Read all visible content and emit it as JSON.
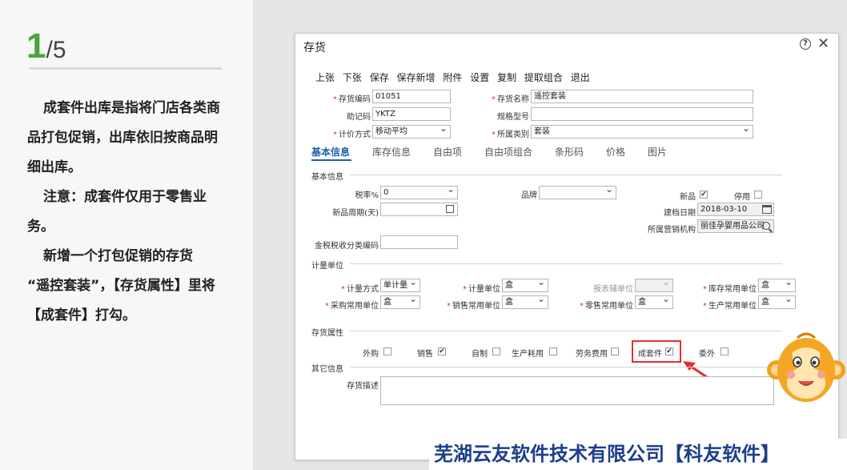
{
  "page": {
    "current": "1",
    "total": "/5"
  },
  "description": {
    "p1": "成套件出库是指将门店各类商品打包促销，出库依旧按商品明细出库。",
    "p2": "注意：成套件仅用于零售业务。",
    "p3a": "新增一个打包促销的存货",
    "p3b": "“遥控套装”，【存货属性】里将【成套件】打勾。"
  },
  "dialog": {
    "title": "存货",
    "help": "?",
    "close": "✕",
    "toolbar": [
      "上张",
      "下张",
      "保存",
      "保存新增",
      "附件",
      "设置",
      "复制",
      "提取组合",
      "退出"
    ],
    "fields": {
      "code_label": "存货编码",
      "code": "01051",
      "name_label": "存货名称",
      "name": "遥控套装",
      "mnemonic_label": "助记码",
      "mnemonic": "YKTZ",
      "spec_label": "规格型号",
      "spec": "",
      "valuation_label": "计价方式",
      "valuation": "移动平均",
      "category_label": "所属类别",
      "category": "套装"
    },
    "tabs": [
      "基本信息",
      "库存信息",
      "自由项",
      "自由项组合",
      "条形码",
      "价格",
      "图片"
    ],
    "basic": {
      "section": "基本信息",
      "tax_label": "税率%",
      "tax": "0",
      "brand_label": "品牌",
      "brand": "",
      "new_label": "新品",
      "new_checked": true,
      "disabled_label": "停用",
      "disabled_checked": false,
      "new_period_label": "新品周期(天)",
      "new_period": "",
      "created_label": "建档日期",
      "created": "2018-03-10",
      "org_label": "所属营销机构",
      "org": "丽佳孕婴用品公司",
      "taxcode_label": "金税税收分类编码",
      "taxcode": ""
    },
    "units": {
      "section": "计量单位",
      "method_label": "计量方式",
      "method": "单计量",
      "unit_label": "计量单位",
      "unit": "盒",
      "report_label": "报表辅单位",
      "report": "",
      "stock_label": "库存常用单位",
      "stock": "盒",
      "purchase_label": "采购常用单位",
      "purchase": "盒",
      "sales_label": "销售常用单位",
      "sales": "盒",
      "retail_label": "零售常用单位",
      "retail": "盒",
      "production_label": "生产常用单位",
      "production": "盒"
    },
    "attributes": {
      "section": "存货属性",
      "items": [
        {
          "label": "外购",
          "checked": false
        },
        {
          "label": "销售",
          "checked": true
        },
        {
          "label": "自制",
          "checked": false
        },
        {
          "label": "生产耗用",
          "checked": false
        },
        {
          "label": "劳务费用",
          "checked": false
        },
        {
          "label": "成套件",
          "checked": true
        },
        {
          "label": "委外",
          "checked": false
        }
      ]
    },
    "other": {
      "section": "其它信息",
      "desc_label": "存货描述",
      "desc": ""
    }
  },
  "check_mark": "✔",
  "footer": "芜湖云友软件技术有限公司【科友软件】",
  "colors": {
    "accent": "#1f5fa8",
    "highlight": "#e03030",
    "page_green": "#4aa63a",
    "footer_text": "#1c3e8a"
  }
}
